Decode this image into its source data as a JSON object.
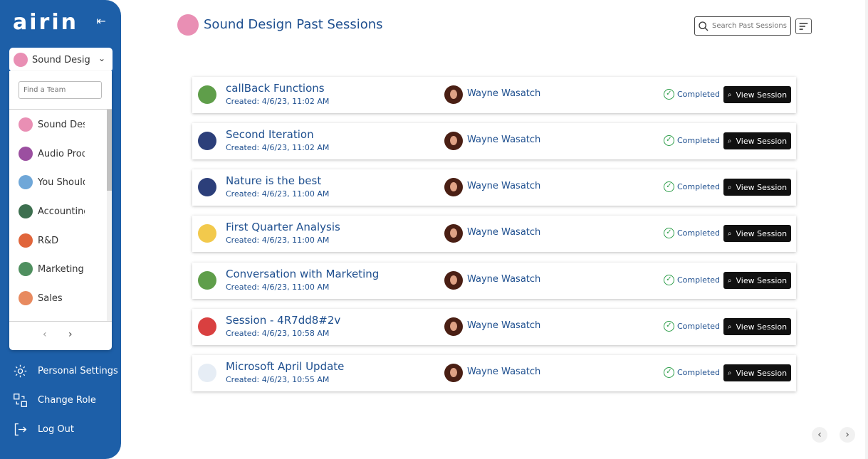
{
  "brand": {
    "logo": "airin"
  },
  "sidebar": {
    "current_team": "Sound Design",
    "find_placeholder": "Find a Team",
    "teams": [
      {
        "label": "Sound Design",
        "color": "#e98fb4"
      },
      {
        "label": "Audio Production",
        "color": "#9b4fa0"
      },
      {
        "label": "You Should Know",
        "color": "#6fa7d8"
      },
      {
        "label": "Accounting",
        "color": "#3d6f4f"
      },
      {
        "label": "R&D",
        "color": "#e0653b"
      },
      {
        "label": "Marketing",
        "color": "#4f8f5f"
      },
      {
        "label": "Sales",
        "color": "#e88a5f"
      }
    ],
    "nav": [
      {
        "label": "Personal Settings",
        "icon": "gear-icon"
      },
      {
        "label": "Change Role",
        "icon": "change-role-icon"
      },
      {
        "label": "Log Out",
        "icon": "logout-icon"
      }
    ]
  },
  "header": {
    "title": "Sound Design Past Sessions",
    "search_placeholder": "Search Past Sessions"
  },
  "sessions": [
    {
      "name": "callBack Functions",
      "created": "Created: 4/6/23, 11:02 AM",
      "user": "Wayne Wasatch",
      "status": "Completed",
      "action": "View Session",
      "icon_color": "#5f9e4a"
    },
    {
      "name": "Second Iteration",
      "created": "Created: 4/6/23, 11:02 AM",
      "user": "Wayne Wasatch",
      "status": "Completed",
      "action": "View Session",
      "icon_color": "#2c3f7a"
    },
    {
      "name": "Nature is the best",
      "created": "Created: 4/6/23, 11:00 AM",
      "user": "Wayne Wasatch",
      "status": "Completed",
      "action": "View Session",
      "icon_color": "#2c3f7a"
    },
    {
      "name": "First Quarter Analysis",
      "created": "Created: 4/6/23, 11:00 AM",
      "user": "Wayne Wasatch",
      "status": "Completed",
      "action": "View Session",
      "icon_color": "#f2c94c"
    },
    {
      "name": "Conversation with Marketing",
      "created": "Created: 4/6/23, 11:00 AM",
      "user": "Wayne Wasatch",
      "status": "Completed",
      "action": "View Session",
      "icon_color": "#5f9e4a"
    },
    {
      "name": "Session - 4R7dd8#2v",
      "created": "Created: 4/6/23, 10:58 AM",
      "user": "Wayne Wasatch",
      "status": "Completed",
      "action": "View Session",
      "icon_color": "#d94040"
    },
    {
      "name": "Microsoft April Update",
      "created": "Created: 4/6/23, 10:55 AM",
      "user": "Wayne Wasatch",
      "status": "Completed",
      "action": "View Session",
      "icon_color": "#e6edf5"
    }
  ]
}
